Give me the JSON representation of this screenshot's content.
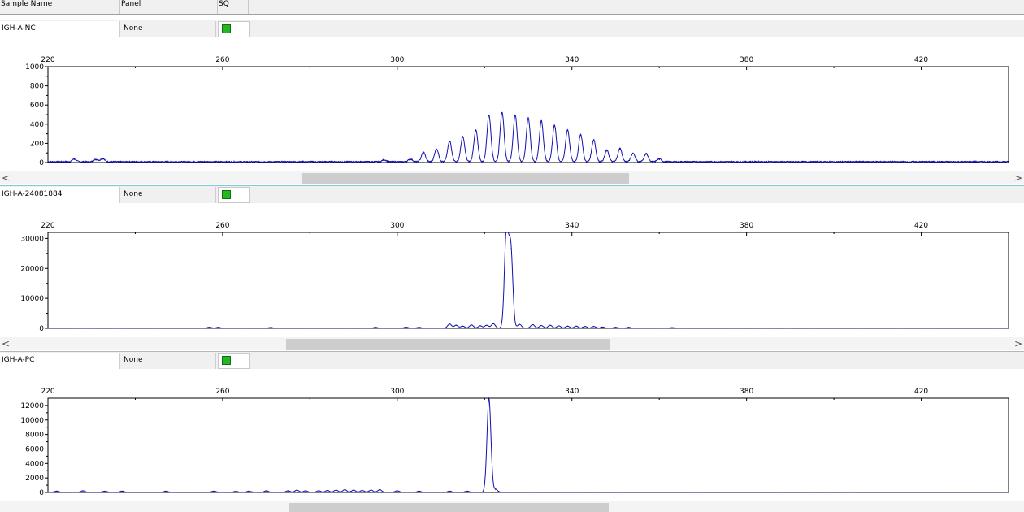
{
  "header": {
    "sample_name": "Sample Name",
    "panel": "Panel",
    "sq": "SQ"
  },
  "colors": {
    "trace": "#1010b0",
    "separator": "#7ccfd6",
    "sq_ok": "#22b822"
  },
  "rows": [
    {
      "sample": "IGH-A-NC",
      "panel": "None",
      "sq_status": "green"
    },
    {
      "sample": "IGH-A-24081884",
      "panel": "None",
      "sq_status": "green"
    },
    {
      "sample": "IGH-A-PC",
      "panel": "None",
      "sq_status": "green"
    }
  ],
  "scroll": {
    "left_arrow": "<",
    "right_arrow": ">",
    "positions": [
      {
        "start": 0.29,
        "end": 0.617
      },
      {
        "start": 0.274,
        "end": 0.598
      },
      {
        "start": 0.277,
        "end": 0.597
      }
    ]
  },
  "chart_data": [
    {
      "type": "line",
      "xlim": [
        220,
        440
      ],
      "x_ticks": [
        220,
        260,
        300,
        340,
        380,
        420
      ],
      "x_tick_labels": [
        "220",
        "260",
        "300",
        "340",
        "380",
        "420"
      ],
      "ylim": [
        0,
        1000
      ],
      "y_ticks": [
        0,
        200,
        400,
        600,
        800,
        1000
      ],
      "y_tick_labels": [
        "0",
        "200",
        "400",
        "600",
        "800",
        "1000"
      ],
      "baseline_noise": 12,
      "peaks": [
        {
          "x": 226,
          "y": 30
        },
        {
          "x": 231,
          "y": 25
        },
        {
          "x": 232.5,
          "y": 35
        },
        {
          "x": 297,
          "y": 20
        },
        {
          "x": 303,
          "y": 28
        },
        {
          "x": 306,
          "y": 100
        },
        {
          "x": 309,
          "y": 135
        },
        {
          "x": 312,
          "y": 215
        },
        {
          "x": 315,
          "y": 260
        },
        {
          "x": 318,
          "y": 330
        },
        {
          "x": 321,
          "y": 490
        },
        {
          "x": 324,
          "y": 520
        },
        {
          "x": 327,
          "y": 490
        },
        {
          "x": 330,
          "y": 455
        },
        {
          "x": 333,
          "y": 430
        },
        {
          "x": 336,
          "y": 380
        },
        {
          "x": 339,
          "y": 335
        },
        {
          "x": 342,
          "y": 285
        },
        {
          "x": 345,
          "y": 230
        },
        {
          "x": 348,
          "y": 120
        },
        {
          "x": 351,
          "y": 140
        },
        {
          "x": 354,
          "y": 90
        },
        {
          "x": 357,
          "y": 85
        },
        {
          "x": 360,
          "y": 30
        }
      ]
    },
    {
      "type": "line",
      "xlim": [
        220,
        440
      ],
      "x_ticks": [
        220,
        260,
        300,
        340,
        380,
        420
      ],
      "x_tick_labels": [
        "220",
        "260",
        "300",
        "340",
        "380",
        "420"
      ],
      "ylim": [
        0,
        32000
      ],
      "y_ticks": [
        0,
        10000,
        20000,
        30000
      ],
      "y_tick_labels": [
        "0",
        "10000",
        "20000",
        "30000"
      ],
      "baseline_noise": 60,
      "peaks": [
        {
          "x": 257,
          "y": 350
        },
        {
          "x": 259,
          "y": 300
        },
        {
          "x": 271,
          "y": 250
        },
        {
          "x": 295,
          "y": 300
        },
        {
          "x": 302,
          "y": 350
        },
        {
          "x": 305,
          "y": 300
        },
        {
          "x": 312,
          "y": 1400
        },
        {
          "x": 313.5,
          "y": 1000
        },
        {
          "x": 315,
          "y": 700
        },
        {
          "x": 317,
          "y": 1100
        },
        {
          "x": 319,
          "y": 800
        },
        {
          "x": 320.5,
          "y": 1000
        },
        {
          "x": 322,
          "y": 1500
        },
        {
          "x": 325,
          "y": 32000
        },
        {
          "x": 326,
          "y": 26500
        },
        {
          "x": 328,
          "y": 1300
        },
        {
          "x": 331,
          "y": 1200
        },
        {
          "x": 333,
          "y": 900
        },
        {
          "x": 335,
          "y": 1000
        },
        {
          "x": 337,
          "y": 800
        },
        {
          "x": 339,
          "y": 700
        },
        {
          "x": 341,
          "y": 700
        },
        {
          "x": 343,
          "y": 600
        },
        {
          "x": 345,
          "y": 600
        },
        {
          "x": 347,
          "y": 400
        },
        {
          "x": 350,
          "y": 300
        },
        {
          "x": 353,
          "y": 300
        },
        {
          "x": 363,
          "y": 200
        }
      ]
    },
    {
      "type": "line",
      "xlim": [
        220,
        440
      ],
      "x_ticks": [
        220,
        260,
        300,
        340,
        380,
        420
      ],
      "x_tick_labels": [
        "220",
        "260",
        "300",
        "340",
        "380",
        "420"
      ],
      "ylim": [
        0,
        13000
      ],
      "y_ticks": [
        0,
        2000,
        4000,
        6000,
        8000,
        10000,
        12000
      ],
      "y_tick_labels": [
        "0",
        "2000",
        "4000",
        "6000",
        "8000",
        "10000",
        "12000"
      ],
      "baseline_noise": 40,
      "peaks": [
        {
          "x": 222,
          "y": 150
        },
        {
          "x": 228,
          "y": 200
        },
        {
          "x": 233,
          "y": 150
        },
        {
          "x": 237,
          "y": 150
        },
        {
          "x": 247,
          "y": 150
        },
        {
          "x": 258,
          "y": 150
        },
        {
          "x": 263,
          "y": 120
        },
        {
          "x": 266,
          "y": 150
        },
        {
          "x": 270,
          "y": 200
        },
        {
          "x": 275,
          "y": 200
        },
        {
          "x": 277,
          "y": 300
        },
        {
          "x": 279,
          "y": 200
        },
        {
          "x": 282,
          "y": 200
        },
        {
          "x": 284,
          "y": 250
        },
        {
          "x": 286,
          "y": 300
        },
        {
          "x": 288,
          "y": 350
        },
        {
          "x": 290,
          "y": 300
        },
        {
          "x": 292,
          "y": 250
        },
        {
          "x": 294,
          "y": 300
        },
        {
          "x": 296,
          "y": 350
        },
        {
          "x": 300,
          "y": 200
        },
        {
          "x": 305,
          "y": 150
        },
        {
          "x": 312,
          "y": 150
        },
        {
          "x": 316,
          "y": 150
        },
        {
          "x": 321,
          "y": 13000
        },
        {
          "x": 322.5,
          "y": 400
        }
      ]
    }
  ]
}
